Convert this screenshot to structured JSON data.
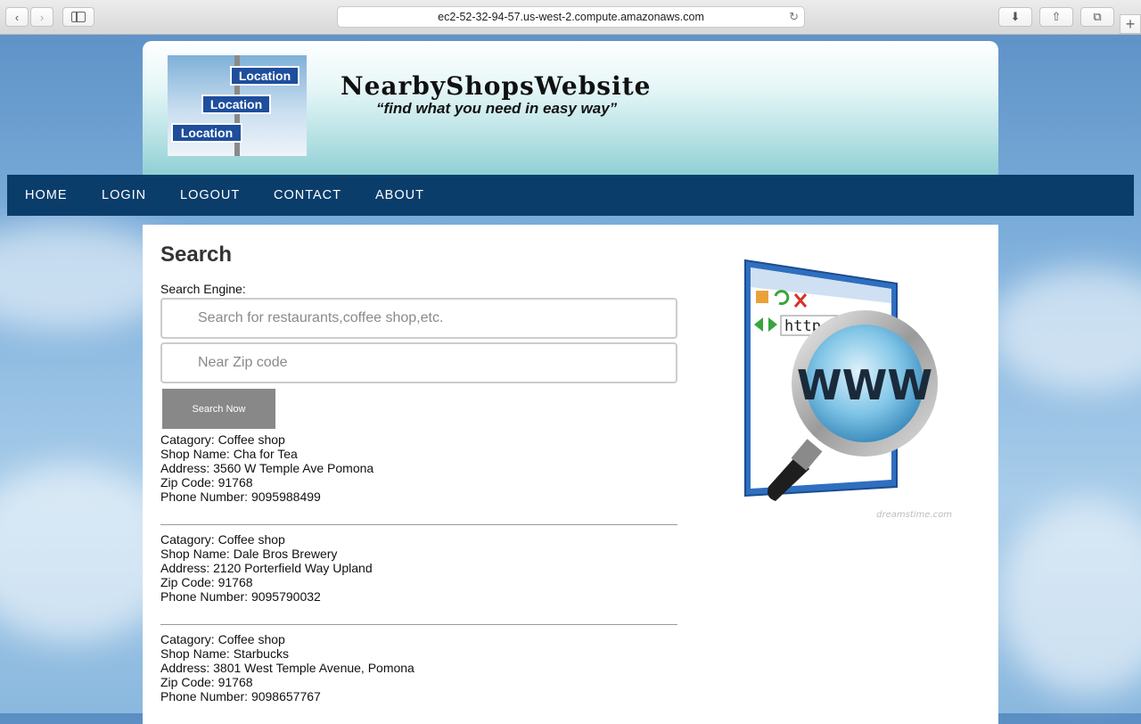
{
  "browser": {
    "url": "ec2-52-32-94-57.us-west-2.compute.amazonaws.com",
    "back_glyph": "‹",
    "forward_glyph": "›",
    "reload_glyph": "↻",
    "download_glyph": "⬇",
    "share_glyph": "⇧",
    "tabs_glyph": "⧉",
    "new_tab_glyph": "+"
  },
  "header": {
    "title": "NearbyShopsWebsite",
    "tagline": "“find what you need in easy way”",
    "logo_signs": [
      "Location",
      "Location",
      "Location"
    ]
  },
  "nav": {
    "items": [
      {
        "label": "HOME"
      },
      {
        "label": "LOGIN"
      },
      {
        "label": "LOGOUT"
      },
      {
        "label": "CONTACT"
      },
      {
        "label": "ABOUT"
      }
    ]
  },
  "search": {
    "heading": "Search",
    "engine_label": "Search Engine:",
    "query_placeholder": "Search for restaurants,coffee shop,etc.",
    "zip_placeholder": "Near Zip code",
    "button_label": "Search Now"
  },
  "results": [
    {
      "category": "Catagory: Coffee shop",
      "name": "Shop Name: Cha for Tea",
      "address": "Address: 3560 W Temple Ave Pomona",
      "zip": "Zip Code: 91768",
      "phone": "Phone Number: 9095988499"
    },
    {
      "category": "Catagory: Coffee shop",
      "name": "Shop Name: Dale Bros Brewery",
      "address": "Address: 2120 Porterfield Way Upland",
      "zip": "Zip Code: 91768",
      "phone": "Phone Number: 9095790032"
    },
    {
      "category": "Catagory: Coffee shop",
      "name": "Shop Name: Starbucks",
      "address": "Address: 3801 West Temple Avenue, Pomona",
      "zip": "Zip Code: 91768",
      "phone": "Phone Number: 9098657767"
    }
  ],
  "illustration": {
    "url_text": "http://",
    "lens_text": "WWW",
    "watermark": "dreamstime.com"
  },
  "colors": {
    "nav_bg": "#0b3d6b",
    "button_bg": "#888888",
    "sign_blue": "#1e4e9c"
  }
}
